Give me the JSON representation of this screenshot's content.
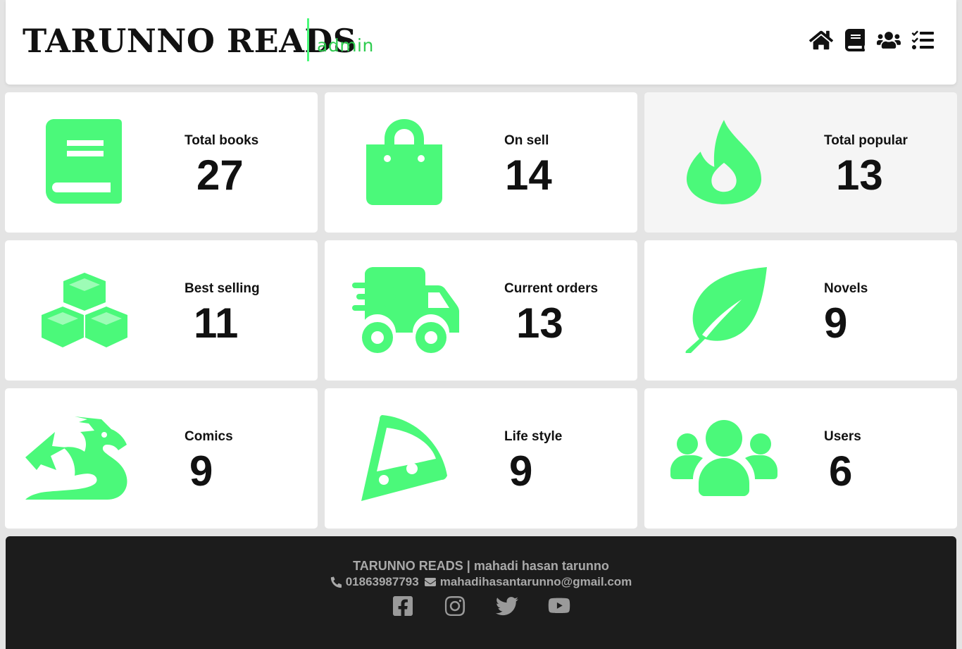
{
  "header": {
    "brand": "TARUNNO READS",
    "role": "admin",
    "accent_color": "#4bf97a",
    "nav_icons": [
      "home-icon",
      "book-icon",
      "users-icon",
      "tasks-icon"
    ]
  },
  "cards": [
    {
      "label": "Total books",
      "value": "27",
      "icon": "book-icon"
    },
    {
      "label": "On sell",
      "value": "14",
      "icon": "shopping-bag-icon"
    },
    {
      "label": "Total popular",
      "value": "13",
      "icon": "fire-icon"
    },
    {
      "label": "Best selling",
      "value": "11",
      "icon": "cubes-icon"
    },
    {
      "label": "Current orders",
      "value": "13",
      "icon": "delivery-truck-icon"
    },
    {
      "label": "Novels",
      "value": "9",
      "icon": "feather-icon"
    },
    {
      "label": "Comics",
      "value": "9",
      "icon": "dragon-icon"
    },
    {
      "label": "Life style",
      "value": "9",
      "icon": "pizza-slice-icon"
    },
    {
      "label": "Users",
      "value": "6",
      "icon": "users-icon"
    }
  ],
  "footer": {
    "title": "TARUNNO READS | mahadi hasan tarunno",
    "phone": "01863987793",
    "email": "mahadihasantarunno@gmail.com",
    "socials": [
      "facebook-icon",
      "instagram-icon",
      "twitter-icon",
      "youtube-icon"
    ]
  }
}
